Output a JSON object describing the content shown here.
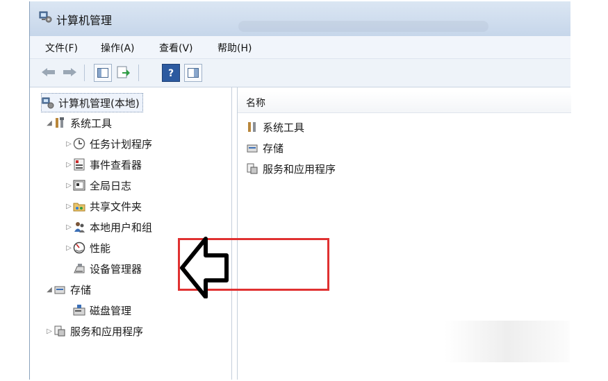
{
  "window": {
    "title": "计算机管理"
  },
  "menu": {
    "file": "文件(F)",
    "action": "操作(A)",
    "view": "查看(V)",
    "help": "帮助(H)"
  },
  "toolbar": {
    "buttons": [
      "back-icon",
      "forward-icon",
      "console-tree-icon",
      "export-list-icon",
      "help-icon",
      "properties-icon"
    ]
  },
  "tree": {
    "root": "计算机管理(本地)",
    "system_tools": "系统工具",
    "task_scheduler": "任务计划程序",
    "event_viewer": "事件查看器",
    "global_log": "全局日志",
    "shared_folders": "共享文件夹",
    "local_users": "本地用户和组",
    "performance": "性能",
    "device_manager": "设备管理器",
    "storage": "存储",
    "disk_management": "磁盘管理",
    "services_apps": "服务和应用程序"
  },
  "list": {
    "column_name": "名称",
    "items": [
      "系统工具",
      "存储",
      "服务和应用程序"
    ]
  },
  "annotation": {
    "highlight_color": "#e03131"
  }
}
